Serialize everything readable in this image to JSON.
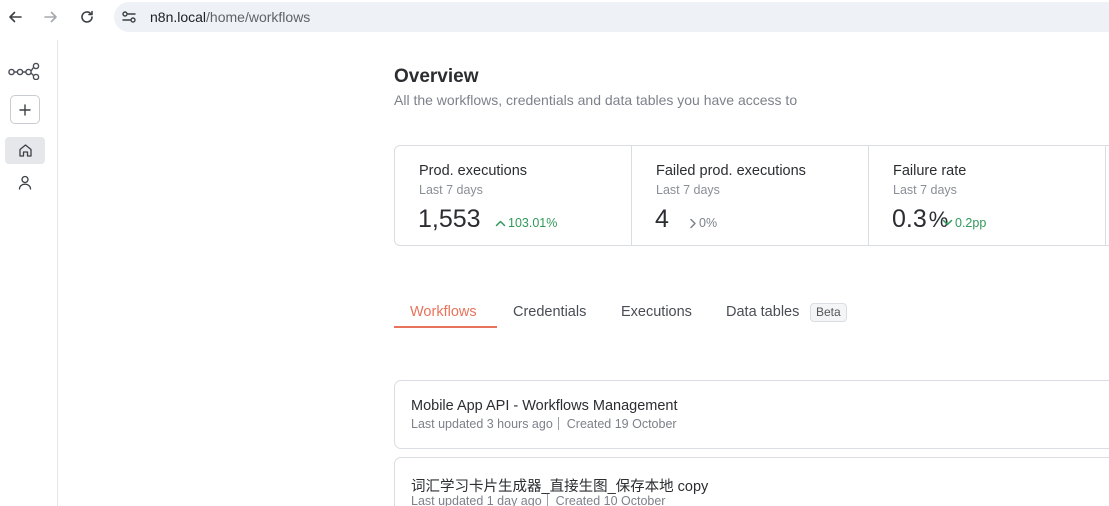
{
  "browser": {
    "url_host": "n8n.local",
    "url_path": "/home/workflows"
  },
  "header": {
    "title": "Overview",
    "subtitle": "All the workflows, credentials and data tables you have access to"
  },
  "stats": [
    {
      "label": "Prod. executions",
      "period": "Last 7 days",
      "value": "1,553",
      "delta": "103.01%",
      "trend": "up"
    },
    {
      "label": "Failed prod. executions",
      "period": "Last 7 days",
      "value": "4",
      "delta": "0%",
      "trend": "neutral"
    },
    {
      "label": "Failure rate",
      "period": "Last 7 days",
      "value": "0.3",
      "value_unit": "%",
      "delta": "0.2pp",
      "trend": "down-good"
    }
  ],
  "tabs": {
    "workflows": "Workflows",
    "credentials": "Credentials",
    "executions": "Executions",
    "data_tables": "Data tables",
    "beta": "Beta"
  },
  "workflows": [
    {
      "name": "Mobile App API - Workflows Management",
      "updated": "Last updated 3 hours ago",
      "created": "Created 19 October"
    },
    {
      "name": "词汇学习卡片生成器_直接生图_保存本地 copy",
      "updated": "Last updated 1 day ago",
      "created": "Created 10 October"
    }
  ],
  "colors": {
    "accent": "#e8735c",
    "positive": "#2f9a5b",
    "muted": "#7d818a"
  },
  "icons": {
    "back": "arrow-left-icon",
    "forward": "arrow-right-icon",
    "reload": "reload-icon",
    "site": "site-settings-icon",
    "logo": "n8n-logo-icon",
    "add": "plus-icon",
    "home": "home-icon",
    "user": "user-icon"
  }
}
